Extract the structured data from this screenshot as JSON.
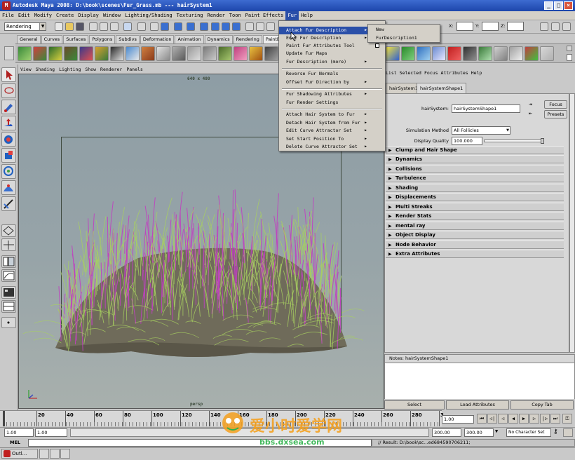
{
  "window": {
    "title": "Autodesk Maya 2008: D:\\book\\scenes\\Fur_Grass.mb   ---   hairSystem1",
    "minimize": "_",
    "maximize": "□",
    "close": "×"
  },
  "menubar": [
    "File",
    "Edit",
    "Modify",
    "Create",
    "Display",
    "Window",
    "Lighting/Shading",
    "Texturing",
    "Render",
    "Toon",
    "Paint Effects",
    "Fur",
    "Help"
  ],
  "statusline": {
    "mode": "Rendering",
    "xyz_labels": [
      "X:",
      "Y:",
      "Z:"
    ]
  },
  "shelf_tabs": [
    "General",
    "Curves",
    "Surfaces",
    "Polygons",
    "Subdivs",
    "Deformation",
    "Animation",
    "Dynamics",
    "Rendering",
    "PaintEffects"
  ],
  "viewport": {
    "menu": [
      "View",
      "Shading",
      "Lighting",
      "Show",
      "Renderer",
      "Panels"
    ],
    "resolution": "640 x 480",
    "camera": "persp"
  },
  "fur_menu": {
    "items": [
      {
        "label": "Attach Fur Description",
        "submenu": true,
        "highlighted": true
      },
      {
        "label": "Edit Fur Description",
        "submenu": true
      },
      {
        "label": "Paint Fur Attributes Tool",
        "option_box": true
      },
      {
        "label": "Update Fur Maps"
      },
      {
        "label": "Fur Description (more)",
        "submenu": true
      },
      {
        "label": "Reverse Fur Normals"
      },
      {
        "label": "Offset Fur Direction by",
        "submenu": true
      },
      {
        "label": "Fur Shadowing Attributes",
        "submenu": true
      },
      {
        "label": "Fur Render Settings"
      },
      {
        "label": "Attach Hair System to Fur",
        "submenu": true
      },
      {
        "label": "Detach Hair System from Fur",
        "submenu": true
      },
      {
        "label": "Edit Curve Attractor Set",
        "submenu": true
      },
      {
        "label": "Set Start Position To",
        "submenu": true
      },
      {
        "label": "Delete Curve Attractor Set",
        "submenu": true
      }
    ],
    "submenu": [
      "New",
      "FurDescription1"
    ]
  },
  "attribute_editor": {
    "menu": [
      "List",
      "Selected",
      "Focus",
      "Attributes",
      "Help"
    ],
    "tabs": [
      "hairSystem1",
      "hairSystemShape1"
    ],
    "node_label": "hairSystem:",
    "node_value": "hairSystemShape1",
    "focus_button": "Focus",
    "presets_button": "Presets",
    "simulation_method_label": "Simulation Method",
    "simulation_method_value": "All Follicles",
    "display_quality_label": "Display Quality",
    "display_quality_value": "100.000",
    "sections": [
      "Clump and Hair Shape",
      "Dynamics",
      "Collisions",
      "Turbulence",
      "Shading",
      "Displacements",
      "Multi Streaks",
      "Render Stats",
      "mental ray",
      "Object Display",
      "Node Behavior",
      "Extra Attributes"
    ],
    "notes_label": "Notes:  hairSystemShape1",
    "buttons": [
      "Select",
      "Load Attributes",
      "Copy Tab"
    ]
  },
  "timeline": {
    "ticks": [
      "20",
      "40",
      "60",
      "80",
      "100",
      "120",
      "140",
      "160",
      "180",
      "200",
      "220",
      "240",
      "260",
      "280"
    ],
    "last_tick": "3",
    "current_frame": "1.00"
  },
  "range": {
    "start": "1.00",
    "start_inner": "1.00",
    "end_inner": "300.00",
    "end": "300.00",
    "character_set": "No Character Set"
  },
  "command_line": {
    "label": "MEL",
    "result": "// Result: D:\\book\\sc…ed684590706211;"
  },
  "taskbar": {
    "item": "Outl..."
  },
  "watermark": {
    "main": "爱小时爱学网",
    "url": "bbs.dxsea.com"
  },
  "colors": {
    "title_bar": "#2450b8",
    "menu_highlight": "#2a4fa8",
    "grass_magenta": "#c040c0",
    "grass_green": "#a8d060",
    "ground": "#6f6b5a",
    "watermark_orange": "#f5a01e",
    "watermark_green": "#2fb24c"
  }
}
